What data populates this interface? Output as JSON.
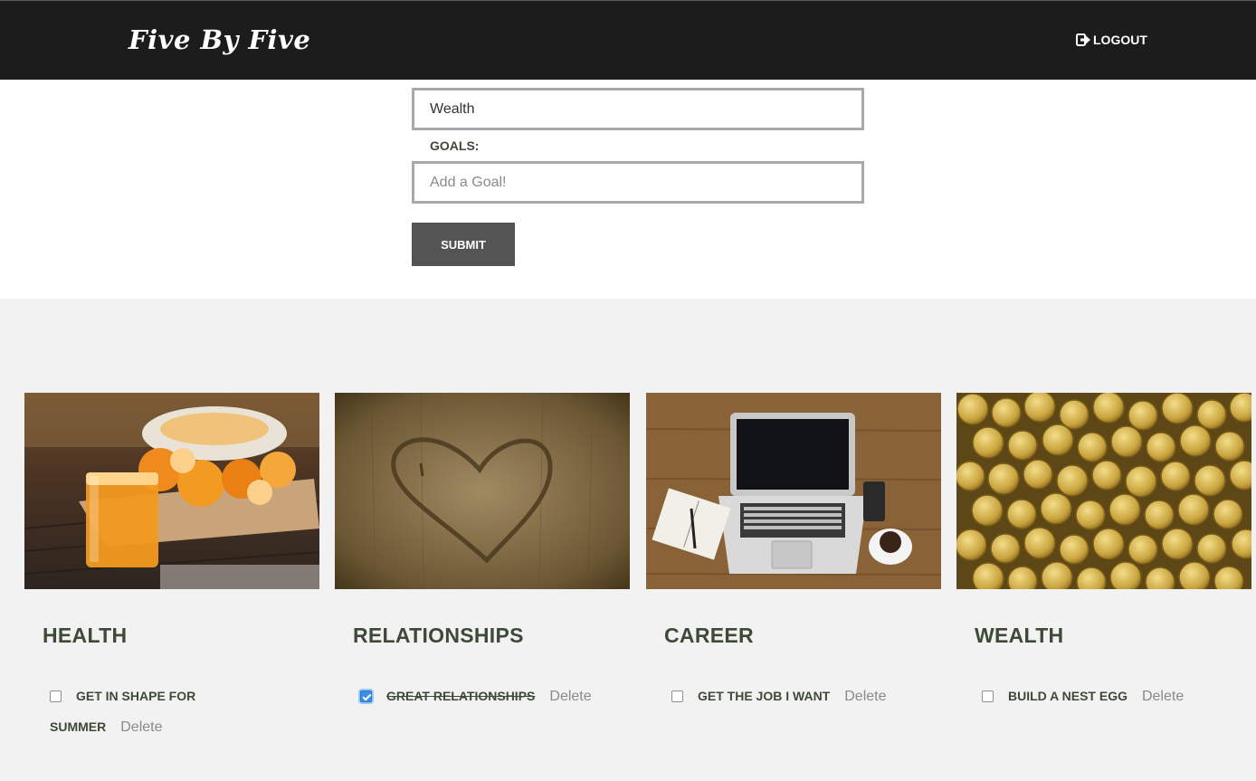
{
  "navbar": {
    "brand": "Five By Five",
    "logout_label": "LOGOUT"
  },
  "form": {
    "category_value": "Wealth",
    "goals_label": "GOALS:",
    "goal_placeholder": "Add a Goal!",
    "submit_label": "SUBMIT"
  },
  "cards": [
    {
      "title": "HEALTH",
      "goal_line1": "GET IN SHAPE FOR",
      "goal_line2": "SUMMER",
      "checked": false,
      "delete_label": "Delete"
    },
    {
      "title": "RELATIONSHIPS",
      "goal": "GREAT RELATIONSHIPS",
      "checked": true,
      "delete_label": "Delete"
    },
    {
      "title": "CAREER",
      "goal": "GET THE JOB I WANT",
      "checked": false,
      "delete_label": "Delete"
    },
    {
      "title": "WEALTH",
      "goal": "BUILD A NEST EGG",
      "checked": false,
      "delete_label": "Delete"
    }
  ],
  "colors": {
    "navbar": "#1c1c1c",
    "heading": "#3e4a38",
    "button": "#545454",
    "background": "#f2f2f2"
  }
}
